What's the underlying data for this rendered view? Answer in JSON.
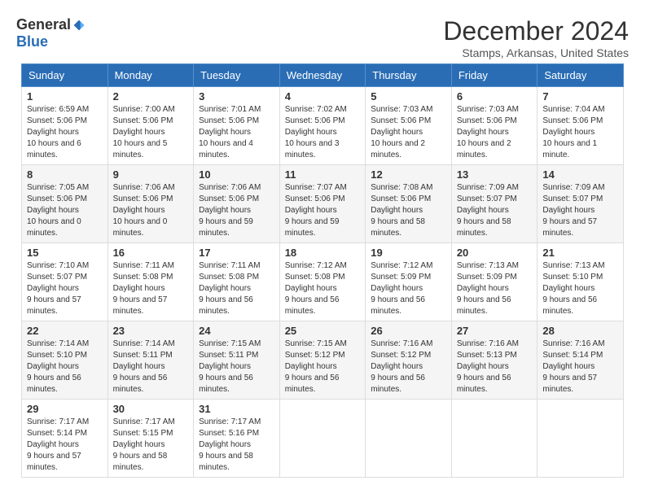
{
  "header": {
    "logo_general": "General",
    "logo_blue": "Blue",
    "month_title": "December 2024",
    "location": "Stamps, Arkansas, United States"
  },
  "days_of_week": [
    "Sunday",
    "Monday",
    "Tuesday",
    "Wednesday",
    "Thursday",
    "Friday",
    "Saturday"
  ],
  "weeks": [
    [
      {
        "day": "1",
        "sunrise": "6:59 AM",
        "sunset": "5:06 PM",
        "daylight": "10 hours and 6 minutes."
      },
      {
        "day": "2",
        "sunrise": "7:00 AM",
        "sunset": "5:06 PM",
        "daylight": "10 hours and 5 minutes."
      },
      {
        "day": "3",
        "sunrise": "7:01 AM",
        "sunset": "5:06 PM",
        "daylight": "10 hours and 4 minutes."
      },
      {
        "day": "4",
        "sunrise": "7:02 AM",
        "sunset": "5:06 PM",
        "daylight": "10 hours and 3 minutes."
      },
      {
        "day": "5",
        "sunrise": "7:03 AM",
        "sunset": "5:06 PM",
        "daylight": "10 hours and 2 minutes."
      },
      {
        "day": "6",
        "sunrise": "7:03 AM",
        "sunset": "5:06 PM",
        "daylight": "10 hours and 2 minutes."
      },
      {
        "day": "7",
        "sunrise": "7:04 AM",
        "sunset": "5:06 PM",
        "daylight": "10 hours and 1 minute."
      }
    ],
    [
      {
        "day": "8",
        "sunrise": "7:05 AM",
        "sunset": "5:06 PM",
        "daylight": "10 hours and 0 minutes."
      },
      {
        "day": "9",
        "sunrise": "7:06 AM",
        "sunset": "5:06 PM",
        "daylight": "10 hours and 0 minutes."
      },
      {
        "day": "10",
        "sunrise": "7:06 AM",
        "sunset": "5:06 PM",
        "daylight": "9 hours and 59 minutes."
      },
      {
        "day": "11",
        "sunrise": "7:07 AM",
        "sunset": "5:06 PM",
        "daylight": "9 hours and 59 minutes."
      },
      {
        "day": "12",
        "sunrise": "7:08 AM",
        "sunset": "5:06 PM",
        "daylight": "9 hours and 58 minutes."
      },
      {
        "day": "13",
        "sunrise": "7:09 AM",
        "sunset": "5:07 PM",
        "daylight": "9 hours and 58 minutes."
      },
      {
        "day": "14",
        "sunrise": "7:09 AM",
        "sunset": "5:07 PM",
        "daylight": "9 hours and 57 minutes."
      }
    ],
    [
      {
        "day": "15",
        "sunrise": "7:10 AM",
        "sunset": "5:07 PM",
        "daylight": "9 hours and 57 minutes."
      },
      {
        "day": "16",
        "sunrise": "7:11 AM",
        "sunset": "5:08 PM",
        "daylight": "9 hours and 57 minutes."
      },
      {
        "day": "17",
        "sunrise": "7:11 AM",
        "sunset": "5:08 PM",
        "daylight": "9 hours and 56 minutes."
      },
      {
        "day": "18",
        "sunrise": "7:12 AM",
        "sunset": "5:08 PM",
        "daylight": "9 hours and 56 minutes."
      },
      {
        "day": "19",
        "sunrise": "7:12 AM",
        "sunset": "5:09 PM",
        "daylight": "9 hours and 56 minutes."
      },
      {
        "day": "20",
        "sunrise": "7:13 AM",
        "sunset": "5:09 PM",
        "daylight": "9 hours and 56 minutes."
      },
      {
        "day": "21",
        "sunrise": "7:13 AM",
        "sunset": "5:10 PM",
        "daylight": "9 hours and 56 minutes."
      }
    ],
    [
      {
        "day": "22",
        "sunrise": "7:14 AM",
        "sunset": "5:10 PM",
        "daylight": "9 hours and 56 minutes."
      },
      {
        "day": "23",
        "sunrise": "7:14 AM",
        "sunset": "5:11 PM",
        "daylight": "9 hours and 56 minutes."
      },
      {
        "day": "24",
        "sunrise": "7:15 AM",
        "sunset": "5:11 PM",
        "daylight": "9 hours and 56 minutes."
      },
      {
        "day": "25",
        "sunrise": "7:15 AM",
        "sunset": "5:12 PM",
        "daylight": "9 hours and 56 minutes."
      },
      {
        "day": "26",
        "sunrise": "7:16 AM",
        "sunset": "5:12 PM",
        "daylight": "9 hours and 56 minutes."
      },
      {
        "day": "27",
        "sunrise": "7:16 AM",
        "sunset": "5:13 PM",
        "daylight": "9 hours and 56 minutes."
      },
      {
        "day": "28",
        "sunrise": "7:16 AM",
        "sunset": "5:14 PM",
        "daylight": "9 hours and 57 minutes."
      }
    ],
    [
      {
        "day": "29",
        "sunrise": "7:17 AM",
        "sunset": "5:14 PM",
        "daylight": "9 hours and 57 minutes."
      },
      {
        "day": "30",
        "sunrise": "7:17 AM",
        "sunset": "5:15 PM",
        "daylight": "9 hours and 58 minutes."
      },
      {
        "day": "31",
        "sunrise": "7:17 AM",
        "sunset": "5:16 PM",
        "daylight": "9 hours and 58 minutes."
      },
      null,
      null,
      null,
      null
    ]
  ],
  "labels": {
    "sunrise": "Sunrise:",
    "sunset": "Sunset:",
    "daylight": "Daylight hours"
  }
}
